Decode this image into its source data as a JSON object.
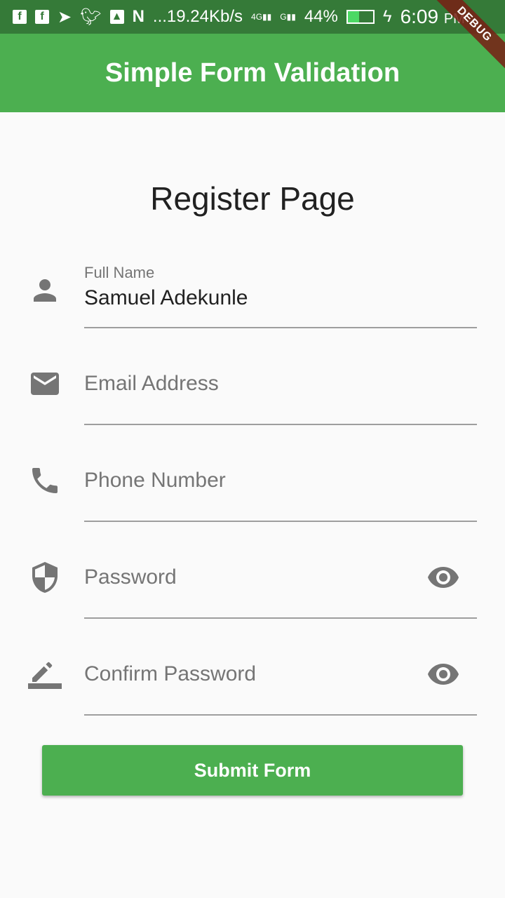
{
  "status_bar": {
    "network_speed": "...19.24Kb/s",
    "battery": "44%",
    "battery_level": 0.44,
    "time": "6:09",
    "ampm": "PM",
    "signal1": "4G",
    "signal2": "G"
  },
  "app_bar": {
    "title": "Simple Form Validation",
    "debug_banner": "DEBUG"
  },
  "page": {
    "title": "Register Page"
  },
  "form": {
    "full_name": {
      "label": "Full Name",
      "value": "Samuel Adekunle",
      "icon": "person-icon"
    },
    "email": {
      "placeholder": "Email Address",
      "icon": "email-icon"
    },
    "phone": {
      "placeholder": "Phone Number",
      "icon": "phone-icon"
    },
    "password": {
      "placeholder": "Password",
      "icon": "shield-icon"
    },
    "confirm_password": {
      "placeholder": "Confirm Password",
      "icon": "edit-icon"
    },
    "submit_label": "Submit Form"
  },
  "colors": {
    "primary": "#4caf50",
    "status_bar": "#357a38"
  }
}
